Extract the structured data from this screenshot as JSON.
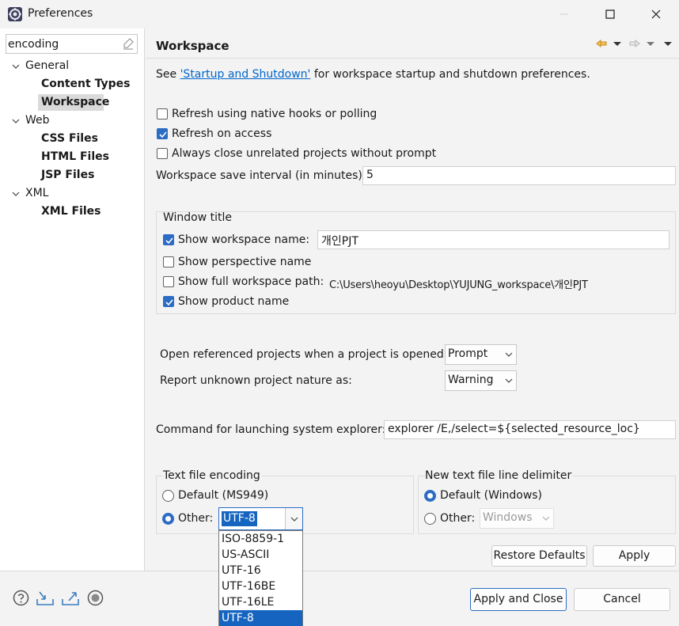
{
  "window": {
    "title": "Preferences"
  },
  "left": {
    "filter_value": "encoding",
    "tree": [
      {
        "label": "General",
        "children": [
          "Content Types",
          "Workspace"
        ]
      },
      {
        "label": "Web",
        "children": [
          "CSS Files",
          "HTML Files",
          "JSP Files"
        ]
      },
      {
        "label": "XML",
        "children": [
          "XML Files"
        ]
      }
    ]
  },
  "page": {
    "title": "Workspace",
    "see_prefix": "See ",
    "see_link": "'Startup and Shutdown'",
    "see_suffix": " for workspace startup and shutdown preferences.",
    "options": {
      "refresh_native": {
        "label": "Refresh using native hooks or polling",
        "checked": false
      },
      "refresh_access": {
        "label": "Refresh on access",
        "checked": true
      },
      "always_close": {
        "label": "Always close unrelated projects without prompt",
        "checked": false
      }
    },
    "save_interval_label": "Workspace save interval (in minutes):",
    "save_interval_value": "5",
    "window_title": {
      "group_label": "Window title",
      "show_ws_name": {
        "label": "Show workspace name:",
        "checked": true,
        "value": "개인PJT"
      },
      "show_perspective": {
        "label": "Show perspective name",
        "checked": false
      },
      "show_full_path": {
        "label": "Show full workspace path:",
        "checked": false,
        "value": "C:\\Users\\heoyu\\Desktop\\YUJUNG_workspace\\개인PJT"
      },
      "show_product": {
        "label": "Show product name",
        "checked": true
      }
    },
    "open_ref_label": "Open referenced projects when a project is opened:",
    "open_ref_value": "Prompt",
    "report_label": "Report unknown project nature as:",
    "report_value": "Warning",
    "explorer_label": "Command for launching system explorer:",
    "explorer_value": "explorer /E,/select=${selected_resource_loc}",
    "encoding": {
      "group_label": "Text file encoding",
      "default_label": "Default (MS949)",
      "other_label": "Other:",
      "other_value": "UTF-8",
      "selected": "other",
      "dropdown_options": [
        "ISO-8859-1",
        "US-ASCII",
        "UTF-16",
        "UTF-16BE",
        "UTF-16LE",
        "UTF-8"
      ],
      "dropdown_selected": "UTF-8"
    },
    "delimiter": {
      "group_label": "New text file line delimiter",
      "default_label": "Default (Windows)",
      "other_label": "Other:",
      "other_value": "Windows",
      "selected": "default"
    },
    "restore_defaults": "Restore Defaults",
    "apply": "Apply"
  },
  "footer": {
    "apply_close": "Apply and Close",
    "cancel": "Cancel",
    "icons": [
      "help-icon",
      "import-icon",
      "export-icon",
      "oomph-record-icon"
    ]
  },
  "colors": {
    "accent": "#2b6cc4",
    "selection": "#1565c0",
    "link": "#0066cc"
  }
}
